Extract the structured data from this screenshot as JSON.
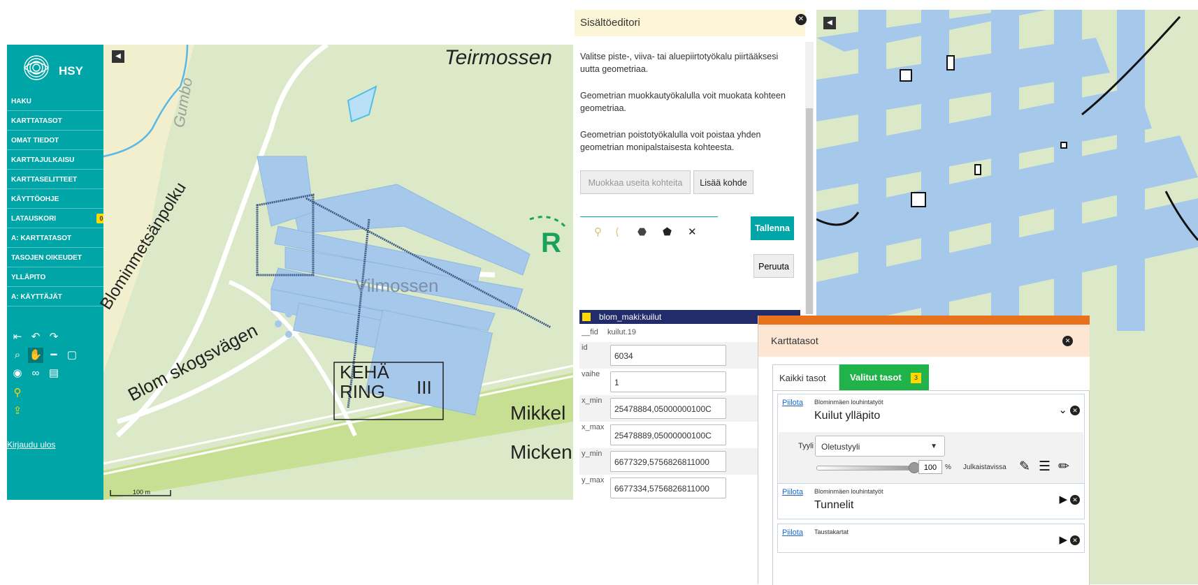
{
  "sidebar": {
    "brand": "HSY",
    "items": [
      {
        "label": "HAKU"
      },
      {
        "label": "KARTTATASOT"
      },
      {
        "label": "OMAT TIEDOT"
      },
      {
        "label": "KARTTAJULKAISU"
      },
      {
        "label": "KARTTASELITTEET"
      },
      {
        "label": "KÄYTTÖOHJE"
      },
      {
        "label": "LATAUSKORI",
        "badge": "0"
      },
      {
        "label": "A: KARTTATASOT"
      },
      {
        "label": "TASOJEN OIKEUDET"
      },
      {
        "label": "YLLÄPITO"
      },
      {
        "label": "A: KÄYTTÄJÄT"
      }
    ],
    "logout": "Kirjaudu ulos",
    "tool_icons": [
      "move-back-icon",
      "undo-icon",
      "redo-icon",
      "zoom-box-icon",
      "pan-hand-icon",
      "measure-line-icon",
      "measure-area-icon",
      "camera-icon",
      "link-icon",
      "print-icon",
      "marker-icon",
      "upload-icon"
    ]
  },
  "map_left": {
    "labels": {
      "teirmossen": "Teirmossen",
      "gumbo": "Gumbo",
      "blomin": "Blominmetsänpolku",
      "blomskog": "Blom skogsvägen",
      "keha1": "KEHÄ",
      "keha2": "RING",
      "keha3": "III",
      "mikkel": "Mikkel",
      "micken": "Micken",
      "r": "R",
      "vilmossen": "Vilmossen"
    },
    "scale": "100 m"
  },
  "editor": {
    "title": "Sisältöeditori",
    "p1": "Valitse piste-, viiva- tai aluepiirtotyökalu piirtääksesi uutta geometriaa.",
    "p2": "Geometrian muokkautyökalulla voit muokata kohteen geometriaa.",
    "p3": "Geometrian poistotyökalulla voit poistaa yhden geometrian monipalstaisesta kohteesta.",
    "edit_many": "Muokkaa useita kohteita",
    "add_feature": "Lisää kohde",
    "save": "Tallenna",
    "cancel": "Peruuta",
    "layer_name": "blom_maki:kuilut",
    "fid_label": "__fid",
    "fid_value": "kuilut.19",
    "fields": [
      {
        "label": "id",
        "value": "6034"
      },
      {
        "label": "vaihe",
        "value": "1"
      },
      {
        "label": "x_min",
        "value": "25478884,05000000100C"
      },
      {
        "label": "x_max",
        "value": "25478889,05000000100C"
      },
      {
        "label": "y_min",
        "value": "6677329,5756826811000"
      },
      {
        "label": "y_max",
        "value": "6677334,5756826811000"
      }
    ]
  },
  "layers": {
    "title": "Karttatasot",
    "tab_all": "Kaikki tasot",
    "tab_selected": "Valitut tasot",
    "selected_count": "3",
    "hide": "Piilota",
    "style_label": "Tyyli",
    "style_value": "Oletustyyli",
    "opacity": "100",
    "opacity_unit": "%",
    "published": "Julkaistavissa",
    "list": [
      {
        "org": "Blominmäen louhintatyöt",
        "name": "Kuilut ylläpito"
      },
      {
        "org": "Blominmäen louhintatyöt",
        "name": "Tunnelit"
      },
      {
        "org": "Taustakartat",
        "name": ""
      }
    ]
  },
  "colors": {
    "teal": "#00a5a8",
    "tunnel": "#a6c9eb",
    "green": "#1fb34a",
    "orange": "#e8721c"
  }
}
